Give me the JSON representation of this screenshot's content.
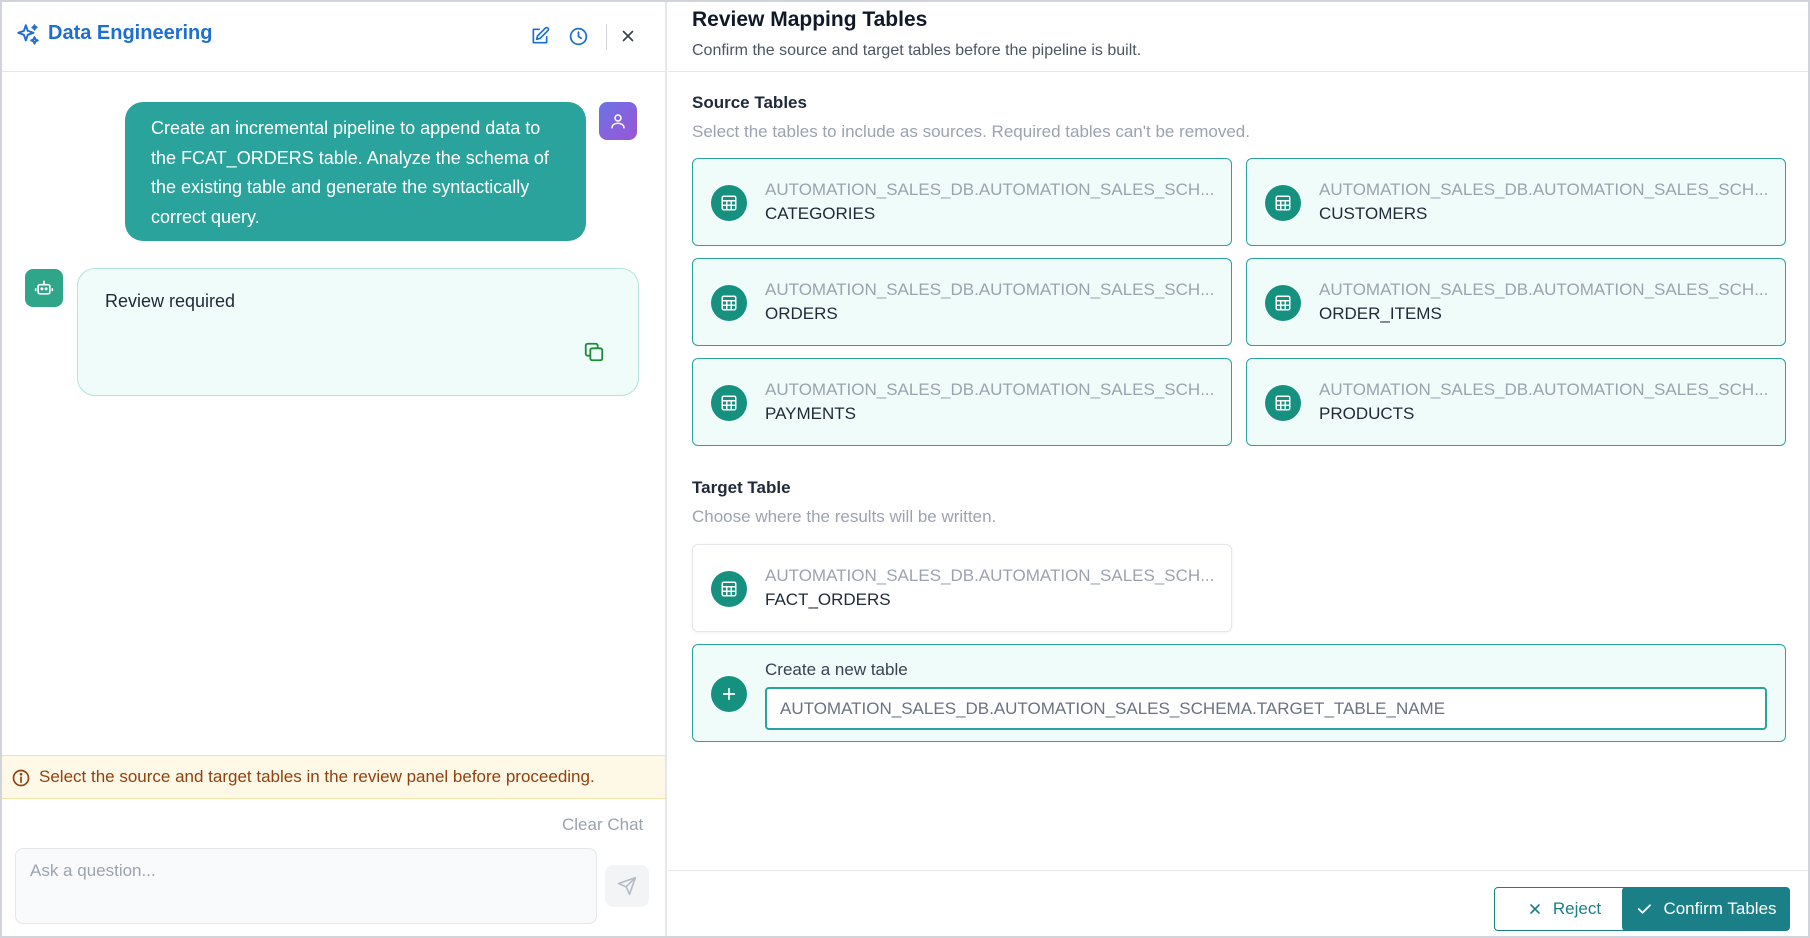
{
  "chat": {
    "title": "Data Engineering",
    "header_icons": [
      "sparkle-icon",
      "edit-icon",
      "history-icon",
      "close-icon"
    ],
    "user_message": "Create an incremental pipeline to append data to the FCAT_ORDERS table. Analyze the schema of the existing table and generate the syntactically correct query.",
    "bot_message": "Review required",
    "notice": "Select the source and target tables in the review panel before proceeding.",
    "clear_chat": "Clear Chat",
    "input_placeholder": "Ask a question..."
  },
  "review": {
    "title": "Review Mapping Tables",
    "subtitle": "Confirm the source and target tables before the pipeline is built.",
    "source": {
      "title": "Source Tables",
      "subtitle": "Select the tables to include as sources. Required tables can't be removed.",
      "tables": [
        {
          "schema": "AUTOMATION_SALES_DB.AUTOMATION_SALES_SCH...",
          "name": "CATEGORIES"
        },
        {
          "schema": "AUTOMATION_SALES_DB.AUTOMATION_SALES_SCH...",
          "name": "CUSTOMERS"
        },
        {
          "schema": "AUTOMATION_SALES_DB.AUTOMATION_SALES_SCH...",
          "name": "ORDERS"
        },
        {
          "schema": "AUTOMATION_SALES_DB.AUTOMATION_SALES_SCH...",
          "name": "ORDER_ITEMS"
        },
        {
          "schema": "AUTOMATION_SALES_DB.AUTOMATION_SALES_SCH...",
          "name": "PAYMENTS"
        },
        {
          "schema": "AUTOMATION_SALES_DB.AUTOMATION_SALES_SCH...",
          "name": "PRODUCTS"
        }
      ]
    },
    "target": {
      "title": "Target Table",
      "subtitle": "Choose where the results will be written.",
      "table": {
        "schema": "AUTOMATION_SALES_DB.AUTOMATION_SALES_SCH...",
        "name": "FACT_ORDERS"
      },
      "new_table_label": "Create a new table",
      "new_table_placeholder": "AUTOMATION_SALES_DB.AUTOMATION_SALES_SCHEMA.TARGET_TABLE_NAME"
    },
    "reject_label": "Reject",
    "confirm_label": "Confirm Tables"
  },
  "colors": {
    "accent": "#2aa39c",
    "button": "#1b7f88",
    "brand_blue": "#1d6fd1",
    "table_icon": "#16907f",
    "notice_text": "#92400e"
  }
}
